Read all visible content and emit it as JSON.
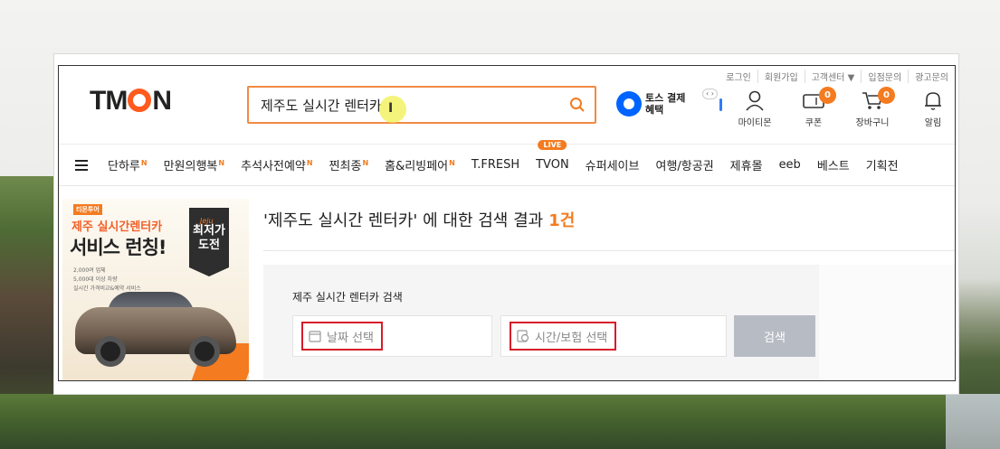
{
  "util_links": [
    "로그인",
    "회원가입",
    "고객센터 ▼",
    "입점문의",
    "광고문의"
  ],
  "logo": {
    "pre": "TM",
    "post": "N"
  },
  "search": {
    "value": "제주도 실시간 렌터카",
    "cursor": "I"
  },
  "toss": {
    "label": "토스 결제혜택",
    "pager": "‹ ›"
  },
  "header_icons": {
    "my": "마이티몬",
    "coupon": "쿠폰",
    "coupon_count": "0",
    "cart": "장바구니",
    "cart_count": "0",
    "alarm": "알림"
  },
  "nav": {
    "items": [
      "단하루",
      "만원의행복",
      "추석사전예약",
      "찐최종",
      "홈&리빙페어",
      "T.FRESH",
      "TVON",
      "슈퍼세이브",
      "여행/항공권",
      "제휴몰",
      "eeb",
      "베스트",
      "기획전"
    ],
    "new_badge": "N",
    "live_badge": "LIVE"
  },
  "banner": {
    "tag": "티몬투어",
    "line1": "제주 실시간렌터카",
    "line2": "서비스 런칭!",
    "bullets": [
      "2,000여 업체",
      "5,000대 이상 차량",
      "실시간 가격비교&예약 서비스"
    ],
    "sign_top": "Jeju",
    "sign": "최저가 도전"
  },
  "result": {
    "query_text": "'제주도 실시간 렌터카' 에 대한 검색 결과",
    "count": "1건"
  },
  "panel": {
    "title": "제주 실시간 렌터카 검색",
    "date_placeholder": "날짜 선택",
    "time_placeholder": "시간/보험 선택",
    "search_button": "검색"
  },
  "colors": {
    "accent": "#f47b20",
    "search_border": "#f28a44",
    "highlight_box": "#d81b2a",
    "toss_blue": "#0064ff"
  }
}
